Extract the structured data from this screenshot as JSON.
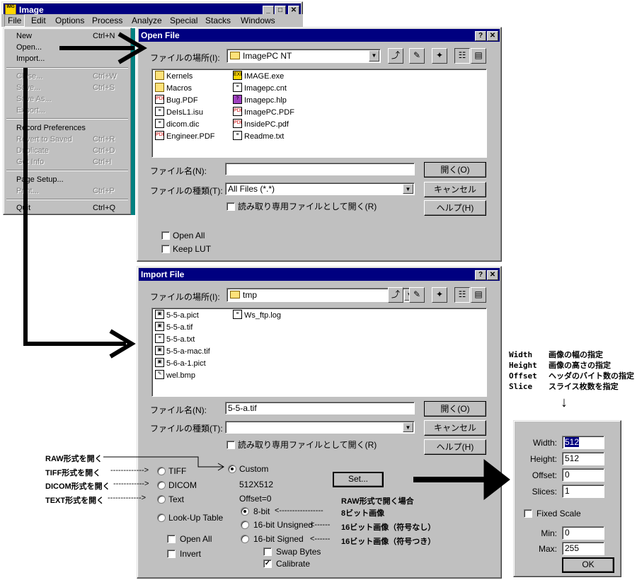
{
  "main_window": {
    "title": "Image",
    "menu": [
      "File",
      "Edit",
      "Options",
      "Process",
      "Analyze",
      "Special",
      "Stacks",
      "Windows"
    ],
    "file_menu": [
      {
        "label": "New",
        "shortcut": "Ctrl+N",
        "enabled": true
      },
      {
        "label": "Open...",
        "shortcut": "",
        "enabled": true
      },
      {
        "label": "Import...",
        "shortcut": "",
        "enabled": true
      },
      {
        "label": "Close...",
        "shortcut": "Ctrl+W",
        "enabled": false
      },
      {
        "label": "Save...",
        "shortcut": "Ctrl+S",
        "enabled": false
      },
      {
        "label": "Save As...",
        "shortcut": "",
        "enabled": false
      },
      {
        "label": "Export...",
        "shortcut": "",
        "enabled": false
      },
      {
        "label": "Record Preferences",
        "shortcut": "",
        "enabled": true
      },
      {
        "label": "Revert to Saved",
        "shortcut": "Ctrl+R",
        "enabled": false
      },
      {
        "label": "Duplicate",
        "shortcut": "Ctrl+D",
        "enabled": false
      },
      {
        "label": "Get Info",
        "shortcut": "Ctrl+I",
        "enabled": false
      },
      {
        "label": "Page Setup...",
        "shortcut": "",
        "enabled": true
      },
      {
        "label": "Print...",
        "shortcut": "Ctrl+P",
        "enabled": false
      },
      {
        "label": "Quit",
        "shortcut": "Ctrl+Q",
        "enabled": true
      }
    ]
  },
  "open_dialog": {
    "title": "Open File",
    "look_in_label": "ファイルの場所(I):",
    "look_in_value": "ImagePC NT",
    "files_col1": [
      {
        "name": "Kernels",
        "type": "folder"
      },
      {
        "name": "Macros",
        "type": "folder"
      },
      {
        "name": "Bug.PDF",
        "type": "pdf"
      },
      {
        "name": "DeIsL1.isu",
        "type": "file"
      },
      {
        "name": "dicom.dic",
        "type": "file"
      },
      {
        "name": "Engineer.PDF",
        "type": "pdf"
      }
    ],
    "files_col2": [
      {
        "name": "IMAGE.exe",
        "type": "exe"
      },
      {
        "name": "Imagepc.cnt",
        "type": "file"
      },
      {
        "name": "Imagepc.hlp",
        "type": "help"
      },
      {
        "name": "ImagePC.PDF",
        "type": "pdf"
      },
      {
        "name": "InsidePC.pdf",
        "type": "pdf"
      },
      {
        "name": "Readme.txt",
        "type": "file"
      }
    ],
    "filename_label": "ファイル名(N):",
    "filename_value": "",
    "filetype_label": "ファイルの種類(T):",
    "filetype_value": "All Files (*.*)",
    "readonly_label": "読み取り専用ファイルとして開く(R)",
    "open_button": "開く(O)",
    "cancel_button": "キャンセル",
    "help_button": "ヘルプ(H)",
    "open_all_label": "Open All",
    "keep_lut_label": "Keep LUT"
  },
  "import_dialog": {
    "title": "Import File",
    "look_in_label": "ファイルの場所(I):",
    "look_in_value": "tmp",
    "files_col1": [
      "5-5-a.pict",
      "5-5-a.tif",
      "5-5-a.txt",
      "5-5-a-mac.tif",
      "5-6-a-1.pict",
      "wel.bmp"
    ],
    "files_col2": [
      "Ws_ftp.log"
    ],
    "filename_label": "ファイル名(N):",
    "filename_value": "5-5-a.tif",
    "filetype_label": "ファイルの種類(T):",
    "filetype_value": "",
    "readonly_label": "読み取り専用ファイルとして開く(R)",
    "open_button": "開く(O)",
    "cancel_button": "キャンセル",
    "help_button": "ヘルプ(H)",
    "tiff_label": "TIFF",
    "dicom_label": "DICOM",
    "text_label": "Text",
    "custom_label": "Custom",
    "size_text": "512X512",
    "offset_text": "Offset=0",
    "set_button": "Set...",
    "lut_label": "Look-Up Table",
    "open_all_label": "Open All",
    "invert_label": "Invert",
    "bit8_label": "8-bit",
    "bit16u_label": "16-bit Unsigned",
    "bit16s_label": "16-bit Signed",
    "swap_label": "Swap Bytes",
    "calibrate_label": "Calibrate"
  },
  "set_panel": {
    "width_label": "Width:",
    "width_value": "512",
    "height_label": "Height:",
    "height_value": "512",
    "offset_label": "Offset:",
    "offset_value": "0",
    "slices_label": "Slices:",
    "slices_value": "1",
    "fixed_scale_label": "Fixed Scale",
    "min_label": "Min:",
    "min_value": "0",
    "max_label": "Max:",
    "max_value": "255",
    "ok_button": "OK"
  },
  "annotations": {
    "raw_open": "RAW形式を開く",
    "tiff_open": "TIFF形式を開く",
    "dicom_open": "DICOM形式を開く",
    "text_open": "TEXT形式を開く",
    "raw_case": "RAW形式で開く場合",
    "bit8": "8ビット画像",
    "bit16u": "16ビット画像（符号なし）",
    "bit16s": "16ビット画像（符号つき）",
    "dash_tiff": "------------->",
    "dash_dicom": "------------>",
    "dash_text": "------------->",
    "dash_8bit": "<-----------------",
    "dash_16u": "<------",
    "dash_16s": "<------",
    "legend": [
      {
        "key": "Width",
        "desc": "画像の幅の指定"
      },
      {
        "key": "Height",
        "desc": "画像の高さの指定"
      },
      {
        "key": "Offset",
        "desc": "ヘッダのバイト数の指定"
      },
      {
        "key": "Slice",
        "desc": "スライス枚数を指定"
      }
    ],
    "down_arrow": "↓"
  },
  "colors": {
    "titlebar": "#000080",
    "face": "#c0c0c0",
    "teal": "#008080"
  }
}
